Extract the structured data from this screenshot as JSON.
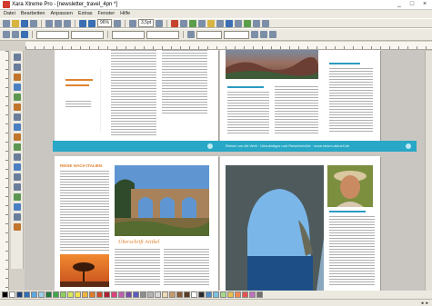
{
  "window": {
    "title": "Xara Xtreme Pro - [newsletter_travel_4pn *]",
    "controls": [
      "_",
      "□",
      "×"
    ]
  },
  "menu": [
    "Datei",
    "Bearbeiten",
    "Anpassen",
    "Extras",
    "Fenster",
    "Hilfe"
  ],
  "toolbar": {
    "zoom_value": "96%",
    "field_value": "3,5pt"
  },
  "document": {
    "p1_heading": "",
    "banner_text": "Reisen um die Welt · Urlaubstipps und Reiseberichte · www.reisen-aktuell.de",
    "p3_heading": "REISE NACH ITALIEN",
    "p3_caption": "Überschrift Artikel"
  },
  "status": {
    "text": "◄ ►"
  },
  "palette": {
    "colors": [
      "#000000",
      "#ffffff",
      "#1c3f7a",
      "#2f6fb7",
      "#5aa8e0",
      "#9ccfe8",
      "#1f7b3c",
      "#3fa94a",
      "#8ccf5a",
      "#d8e85a",
      "#f4e24a",
      "#f0b53a",
      "#e07b28",
      "#d04a28",
      "#b02030",
      "#e0407a",
      "#c05fb0",
      "#7a4aa8",
      "#5b5bc0",
      "#8d8d8d",
      "#b5b5b5",
      "#d8d8d8",
      "#f0d8b0",
      "#c89a6a",
      "#8a5a32",
      "#5a3a20",
      "#ffffff",
      "#2a2a2a",
      "#4a8ac8",
      "#7ac0e0",
      "#a8d88a",
      "#e8c050",
      "#f08850",
      "#e85050",
      "#c070c0",
      "#707070"
    ]
  }
}
